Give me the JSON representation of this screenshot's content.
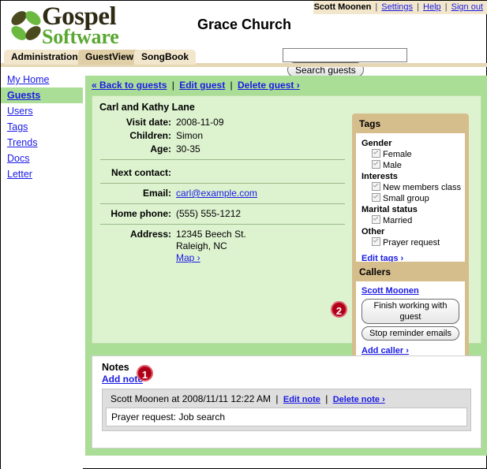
{
  "userbar": {
    "user": "Scott Moonen",
    "links": [
      "Settings",
      "Help",
      "Sign out"
    ],
    "separator": "|"
  },
  "brand": {
    "line1": "Gospel",
    "line2": "Software",
    "logo_icon": "four-leaf-logo-icon",
    "color_dark": "#2e2a13",
    "color_green": "#5aa832"
  },
  "header": {
    "church_title": "Grace Church"
  },
  "search": {
    "value": "",
    "placeholder": "",
    "button_label": "Search guests"
  },
  "tabs": [
    {
      "label": "Administration",
      "active": false
    },
    {
      "label": "GuestView",
      "active": true
    },
    {
      "label": "SongBook",
      "active": false
    }
  ],
  "sidebar": {
    "items": [
      {
        "label": "My Home",
        "active": false
      },
      {
        "label": "Guests",
        "active": true
      },
      {
        "label": "Users",
        "active": false
      },
      {
        "label": "Tags",
        "active": false
      },
      {
        "label": "Trends",
        "active": false
      },
      {
        "label": "Docs",
        "active": false
      },
      {
        "label": "Letter",
        "active": false
      }
    ]
  },
  "breadcrumb": {
    "back": "« Back to guests",
    "edit": "Edit guest",
    "delete": "Delete guest ›",
    "separator": "|"
  },
  "guest": {
    "name": "Carl and Kathy Lane",
    "fields": [
      {
        "label": "Visit date:",
        "value": "2008-11-09"
      },
      {
        "label": "Children:",
        "value": "Simon"
      },
      {
        "label": "Age:",
        "value": "30-35"
      }
    ],
    "next_contact_label": "Next contact:",
    "next_contact_value": "",
    "email_label": "Email:",
    "email_value": "carl@example.com",
    "phone_label": "Home phone:",
    "phone_value": "(555) 555-1212",
    "address_label": "Address:",
    "address_line1": "12345 Beech St.",
    "address_line2": "Raleigh, NC",
    "map_link": "Map ›"
  },
  "tags_panel": {
    "title": "Tags",
    "groups": [
      {
        "name": "Gender",
        "items": [
          {
            "label": "Female",
            "checked": true
          },
          {
            "label": "Male",
            "checked": true
          }
        ]
      },
      {
        "name": "Interests",
        "items": [
          {
            "label": "New members class",
            "checked": true
          },
          {
            "label": "Small group",
            "checked": true
          }
        ]
      },
      {
        "name": "Marital status",
        "items": [
          {
            "label": "Married",
            "checked": true
          }
        ]
      },
      {
        "name": "Other",
        "items": [
          {
            "label": "Prayer request",
            "checked": true
          }
        ]
      }
    ],
    "edit_link": "Edit tags ›"
  },
  "callers_panel": {
    "title": "Callers",
    "caller_name": "Scott Moonen",
    "finish_button": "Finish working with guest",
    "stop_button": "Stop reminder emails",
    "add_link": "Add caller ›"
  },
  "notes": {
    "title": "Notes",
    "add_link": "Add note",
    "items": [
      {
        "meta": "Scott Moonen at 2008/11/11 12:22 AM",
        "edit": "Edit note",
        "delete": "Delete note ›",
        "separator": "|",
        "body": "Prayer request: Job search"
      }
    ]
  },
  "callouts": [
    {
      "number": "1",
      "target": "add-note-link"
    },
    {
      "number": "2",
      "target": "callers-panel-buttons"
    }
  ],
  "colors": {
    "tan_bar": "#f2e7cd",
    "tab_active": "#e0cfa6",
    "frame_green": "#aadd96",
    "content_green": "#ddf2cf",
    "panel_tan": "#d6bd8c",
    "badge_red": "#b00018",
    "link_blue": "#1a1ae6"
  }
}
